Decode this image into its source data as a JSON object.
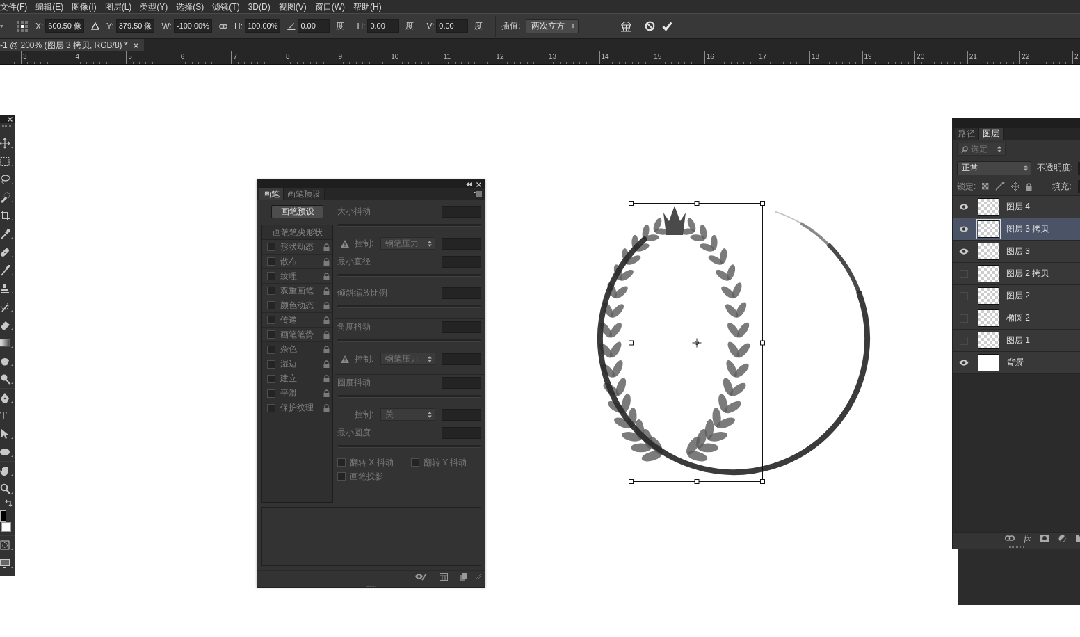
{
  "menu_bar": {
    "items": [
      "文件(F)",
      "编辑(E)",
      "图像(I)",
      "图层(L)",
      "类型(Y)",
      "选择(S)",
      "滤镜(T)",
      "3D(D)",
      "视图(V)",
      "窗口(W)",
      "帮助(H)"
    ]
  },
  "options_bar": {
    "items": [
      {
        "kind": "preset_caret"
      },
      {
        "kind": "reference_grid"
      },
      {
        "kind": "field",
        "label": "X:",
        "value": "600.50 像"
      },
      {
        "kind": "delta_toggle"
      },
      {
        "kind": "field",
        "label": "Y:",
        "value": "379.50 像"
      },
      {
        "kind": "field",
        "label": "W:",
        "value": "-100.00%"
      },
      {
        "kind": "link_toggle"
      },
      {
        "kind": "field",
        "label": "H:",
        "value": "100.00%"
      },
      {
        "kind": "angle_field",
        "value": "0.00",
        "unit": "度"
      },
      {
        "kind": "field",
        "label": "H:",
        "value": "0.00",
        "unit": "度"
      },
      {
        "kind": "field",
        "label": "V:",
        "value": "0.00",
        "unit": "度"
      },
      {
        "kind": "dropdown",
        "label": "插值:",
        "value": "两次立方"
      },
      {
        "kind": "warp_button"
      },
      {
        "kind": "cancel_button"
      },
      {
        "kind": "commit_button"
      }
    ]
  },
  "document_tab": {
    "title": "-1 @ 200% (图层 3 拷贝, RGB/8) *"
  },
  "ruler": {
    "numbers": [
      "3",
      "4",
      "5",
      "6",
      "7",
      "8",
      "9",
      "10",
      "11",
      "12",
      "13",
      "14",
      "15",
      "16",
      "17",
      "18",
      "19",
      "20",
      "21",
      "22",
      "2"
    ]
  },
  "toolbox": {
    "tools": [
      {
        "kind": "move"
      },
      {
        "kind": "marquee"
      },
      {
        "kind": "lasso"
      },
      {
        "kind": "quick_select"
      },
      {
        "kind": "crop"
      },
      {
        "kind": "eyedropper"
      },
      {
        "kind": "healing"
      },
      {
        "kind": "brush"
      },
      {
        "kind": "stamp"
      },
      {
        "kind": "history_brush"
      },
      {
        "kind": "eraser"
      },
      {
        "kind": "gradient"
      },
      {
        "kind": "smudge"
      },
      {
        "kind": "dodge"
      },
      {
        "kind": "pen"
      },
      {
        "kind": "text",
        "glyph": "T"
      },
      {
        "kind": "path_select"
      },
      {
        "kind": "ellipse"
      },
      {
        "kind": "hand"
      },
      {
        "kind": "zoom"
      },
      {
        "kind": "swap"
      },
      {
        "kind": "colors"
      },
      {
        "kind": "quick_mask"
      },
      {
        "kind": "screen_mode"
      }
    ]
  },
  "brush_panel": {
    "tabs": [
      {
        "label": "画笔",
        "selected": true
      },
      {
        "label": "画笔预设",
        "selected": false
      }
    ],
    "presets_button": "画笔预设",
    "tip_shape": "画笔笔尖形状",
    "options": [
      {
        "label": "形状动态",
        "checked": false
      },
      {
        "label": "散布",
        "checked": false
      },
      {
        "label": "纹理",
        "checked": false
      },
      {
        "label": "双重画笔",
        "checked": false
      },
      {
        "label": "颜色动态",
        "checked": false
      },
      {
        "label": "传递",
        "checked": false
      },
      {
        "label": "画笔笔势",
        "checked": false
      },
      {
        "label": "杂色",
        "checked": false
      },
      {
        "label": "湿边",
        "checked": false
      },
      {
        "label": "建立",
        "checked": false
      },
      {
        "label": "平滑",
        "checked": false
      },
      {
        "label": "保护纹理",
        "checked": false
      }
    ],
    "sections": [
      {
        "rows": [
          {
            "kind": "slider",
            "label": "大小抖动"
          },
          {
            "kind": "control",
            "warning": true,
            "label": "控制:",
            "value": "钢笔压力"
          },
          {
            "kind": "slider",
            "label": "最小直径"
          },
          {
            "kind": "slider",
            "label": "倾斜缩放比例"
          }
        ]
      },
      {
        "rows": [
          {
            "kind": "slider",
            "label": "角度抖动"
          },
          {
            "kind": "control",
            "warning": true,
            "label": "控制:",
            "value": "钢笔压力"
          }
        ]
      },
      {
        "rows": [
          {
            "kind": "slider",
            "label": "圆度抖动"
          },
          {
            "kind": "control",
            "warning": false,
            "label": "控制:",
            "value": "关"
          },
          {
            "kind": "slider",
            "label": "最小圆度"
          }
        ]
      }
    ],
    "checkboxes": [
      {
        "label": "翻转 X 抖动",
        "checked": false
      },
      {
        "label": "翻转 Y 抖动",
        "checked": false
      },
      {
        "label": "画笔投影",
        "checked": false
      }
    ]
  },
  "layers_panel": {
    "tabs": [
      {
        "label": "路径",
        "selected": false
      },
      {
        "label": "图层",
        "selected": true
      }
    ],
    "filter": "选定",
    "blend_mode": "正常",
    "opacity_label": "不透明度:",
    "lock_label": "锁定:",
    "fill_label": "填充:",
    "layers": [
      {
        "kind": "layer",
        "name": "图层 4",
        "visible": true,
        "selected": false
      },
      {
        "kind": "layer",
        "name": "图层 3 拷贝",
        "visible": true,
        "selected": true
      },
      {
        "kind": "layer",
        "name": "图层 3",
        "visible": true,
        "selected": false
      },
      {
        "kind": "layer",
        "name": "图层 2 拷贝",
        "visible": false,
        "selected": false
      },
      {
        "kind": "layer",
        "name": "图层 2",
        "visible": false,
        "selected": false
      },
      {
        "kind": "layer",
        "name": "椭圆 2",
        "visible": false,
        "selected": false
      },
      {
        "kind": "layer",
        "name": "图层 1",
        "visible": false,
        "selected": false
      },
      {
        "kind": "background",
        "name": "背景",
        "visible": true,
        "selected": false
      }
    ],
    "footer": [
      {
        "kind": "link"
      },
      {
        "kind": "fx",
        "glyph": "fx"
      },
      {
        "kind": "mask"
      },
      {
        "kind": "adjustment"
      },
      {
        "kind": "folder"
      }
    ]
  }
}
